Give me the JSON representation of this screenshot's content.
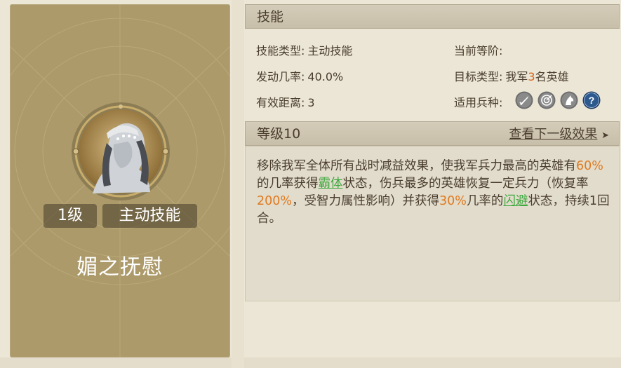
{
  "skill": {
    "level_badge": "1级",
    "type_badge": "主动技能",
    "name": "媚之抚慰"
  },
  "info": {
    "section_title": "技能",
    "type_label": "技能类型:",
    "type_value": "主动技能",
    "rank_label": "当前等阶:",
    "rank_value": "",
    "rate_label": "发动几率:",
    "rate_value": "40.0%",
    "target_label": "目标类型:",
    "target_prefix": "我军",
    "target_count": "3",
    "target_suffix": "名英雄",
    "range_label": "有效距离:",
    "range_value": "3",
    "units_label": "适用兵种:",
    "unit_icons": [
      "sword-icon",
      "target-icon",
      "horse-icon",
      "question-icon"
    ]
  },
  "level_section": {
    "title": "等级10",
    "next_link": "查看下一级效果",
    "next_arrow": "➤"
  },
  "description": {
    "p1": "移除我军全体所有战时减益效果，使我军兵力最高的英雄有",
    "v1": "60%",
    "p2": "的几率获得",
    "k1": "霸体",
    "p3": "状态，伤兵最多的英雄恢复一定兵力（恢复率",
    "v2": "200%",
    "p4": "，受智力属性影响）并获得",
    "v3": "30%",
    "p5": "几率的",
    "k2": "闪避",
    "p6": "状态，持续1回合。"
  },
  "colors": {
    "card": "#ac9a6a",
    "highlight_orange": "#e07a1f",
    "keyword_green": "#3fa83f"
  }
}
